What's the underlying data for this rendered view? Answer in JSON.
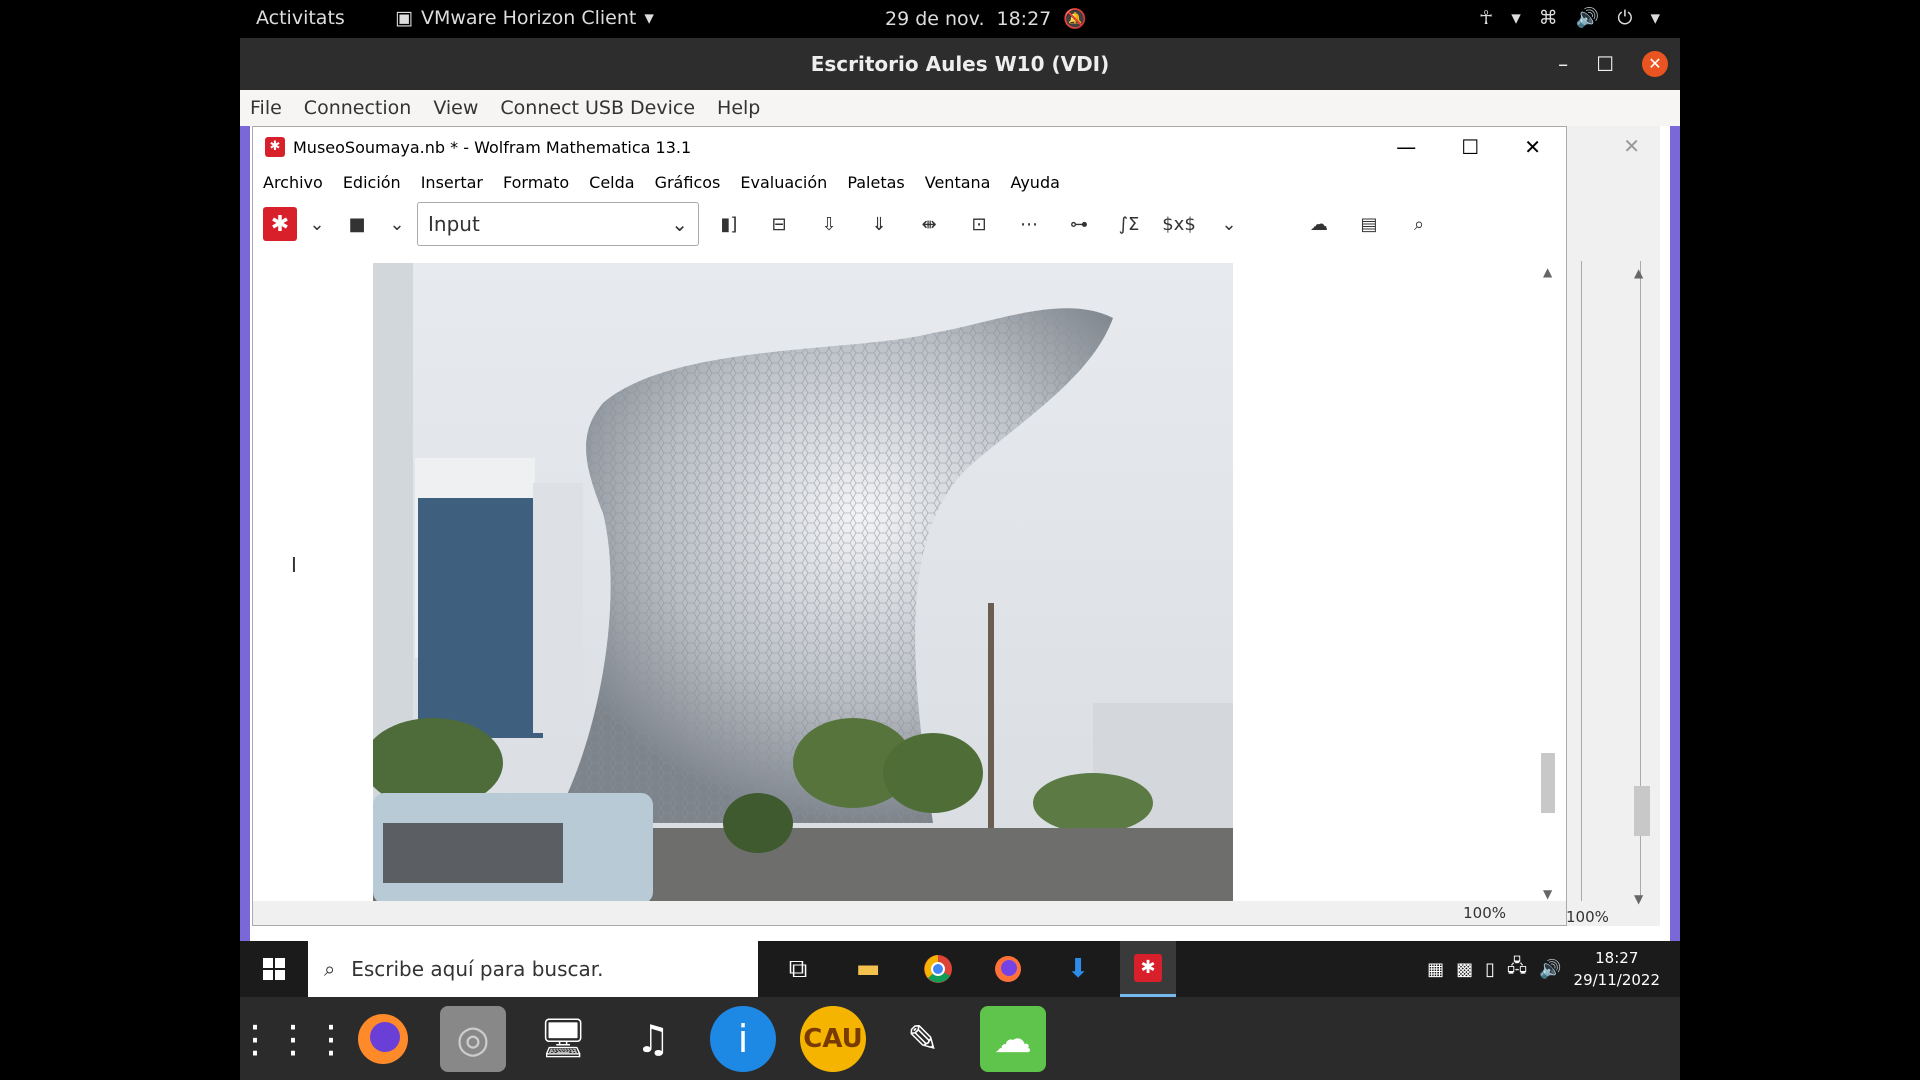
{
  "topbar": {
    "activities": "Activitats",
    "app_menu": "VMware Horizon Client",
    "date": "29 de nov.",
    "time": "18:27"
  },
  "vmware": {
    "title": "Escritorio Aules W10 (VDI)",
    "menu": [
      "File",
      "Connection",
      "View",
      "Connect USB Device",
      "Help"
    ]
  },
  "mathematica": {
    "title": "MuseoSoumaya.nb * - Wolfram Mathematica 13.1",
    "menu": [
      "Archivo",
      "Edición",
      "Insertar",
      "Formato",
      "Celda",
      "Gráficos",
      "Evaluación",
      "Paletas",
      "Ventana",
      "Ayuda"
    ],
    "cell_style": "Input",
    "zoom": "100%",
    "bg_zoom": "100%"
  },
  "taskbar": {
    "search_placeholder": "Escribe aquí para buscar.",
    "time": "18:27",
    "date": "29/11/2022"
  },
  "colors": {
    "mathematica_red": "#d7202a",
    "vm_close": "#e95420",
    "vm_frame": "#7b68d8"
  }
}
